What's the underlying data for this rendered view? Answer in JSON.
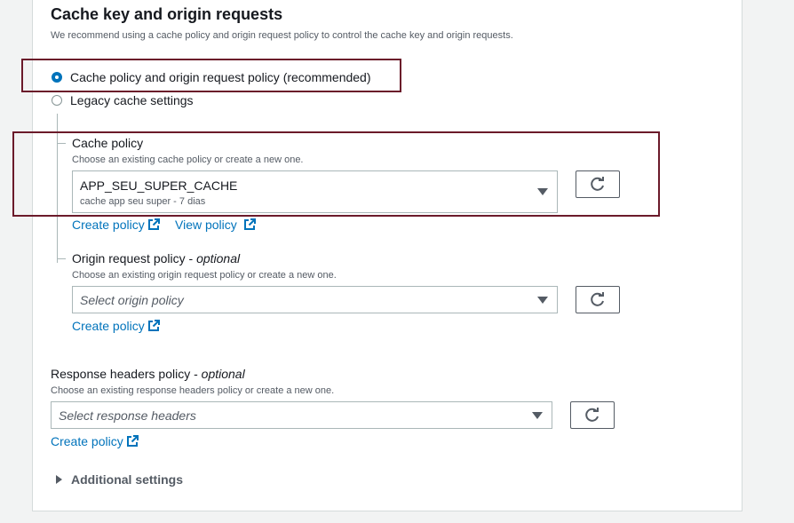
{
  "section": {
    "title": "Cache key and origin requests",
    "description": "We recommend using a cache policy and origin request policy to control the cache key and origin requests."
  },
  "radios": {
    "recommended_label": "Cache policy and origin request policy (recommended)",
    "legacy_label": "Legacy cache settings"
  },
  "cache_policy": {
    "label": "Cache policy",
    "description": "Choose an existing cache policy or create a new one.",
    "selected_value": "APP_SEU_SUPER_CACHE",
    "selected_sub": "cache app seu super - 7 dias",
    "create_link": "Create policy",
    "view_link": "View policy"
  },
  "origin_request_policy": {
    "label": "Origin request policy - ",
    "optional": "optional",
    "description": "Choose an existing origin request policy or create a new one.",
    "placeholder": "Select origin policy",
    "create_link": "Create policy"
  },
  "response_headers_policy": {
    "label": "Response headers policy - ",
    "optional": "optional",
    "description": "Choose an existing response headers policy or create a new one.",
    "placeholder": "Select response headers",
    "create_link": "Create policy"
  },
  "additional_settings": {
    "label": "Additional settings"
  },
  "colors": {
    "accent": "#0073bb",
    "highlight_box": "#6b1a2a"
  }
}
